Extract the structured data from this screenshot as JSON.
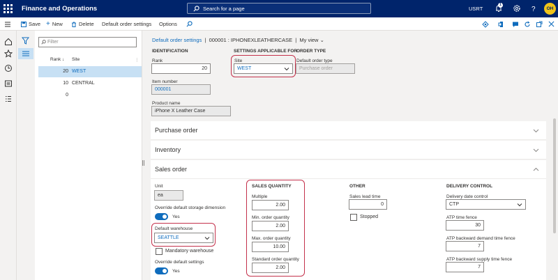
{
  "topbar": {
    "app_name": "Finance and Operations",
    "search_placeholder": "Search for a page",
    "company": "USRT",
    "notification_count": "1",
    "avatar_initials": "OH"
  },
  "actions": {
    "save": "Save",
    "new": "New",
    "delete": "Delete",
    "default_order_settings": "Default order settings",
    "options": "Options",
    "messages_count": "0"
  },
  "list": {
    "filter_placeholder": "Filter",
    "col_rank": "Rank",
    "col_site": "Site",
    "rows": [
      {
        "rank": "20",
        "site": "WEST"
      },
      {
        "rank": "10",
        "site": "CENTRAL"
      },
      {
        "rank": "0",
        "site": ""
      }
    ]
  },
  "breadcrumb": {
    "link": "Default order settings",
    "sep": "|",
    "record": "000001 : IPHONEXLEATHERCASE",
    "sep2": "|",
    "view": "My view"
  },
  "identification": {
    "header": "IDENTIFICATION",
    "rank_label": "Rank",
    "rank_value": "20",
    "item_label": "Item number",
    "item_value": "000001",
    "product_label": "Product name",
    "product_value": "iPhone X Leather Case"
  },
  "settings": {
    "header": "SETTINGS APPLICABLE FOR",
    "site_label": "Site",
    "site_value": "WEST"
  },
  "order_type": {
    "header": "ORDER TYPE",
    "label": "Default order type",
    "value": "Purchase order"
  },
  "fasttabs": {
    "purchase": "Purchase order",
    "inventory": "Inventory",
    "sales": "Sales order"
  },
  "sales": {
    "unit_label": "Unit",
    "unit_value": "ea",
    "override_storage_label": "Override default storage dimension",
    "override_storage_value": "Yes",
    "warehouse_label": "Default warehouse",
    "warehouse_value": "SEATTLE",
    "mandatory_warehouse": "Mandatory warehouse",
    "override_settings_label": "Override default settings",
    "override_settings_value": "Yes",
    "qty_header": "SALES QUANTITY",
    "multiple_label": "Multiple",
    "multiple_value": "2.00",
    "min_label": "Min. order quantity",
    "min_value": "2.00",
    "max_label": "Max. order quantity",
    "max_value": "10.00",
    "std_label": "Standard order quantity",
    "std_value": "2.00",
    "other_header": "OTHER",
    "lead_label": "Sales lead time",
    "lead_value": "0",
    "stopped_label": "Stopped",
    "delivery_header": "DELIVERY CONTROL",
    "ddc_label": "Delivery date control",
    "ddc_value": "CTP",
    "atp_label": "ATP time fence",
    "atp_value": "30",
    "atp_demand_label": "ATP backward demand time fence",
    "atp_demand_value": "7",
    "atp_supply_label": "ATP backward supply time fence",
    "atp_supply_value": "7"
  },
  "colors": {
    "topbar": "#00246b",
    "accent": "#0f6cbd",
    "highlight": "#c4314b"
  }
}
